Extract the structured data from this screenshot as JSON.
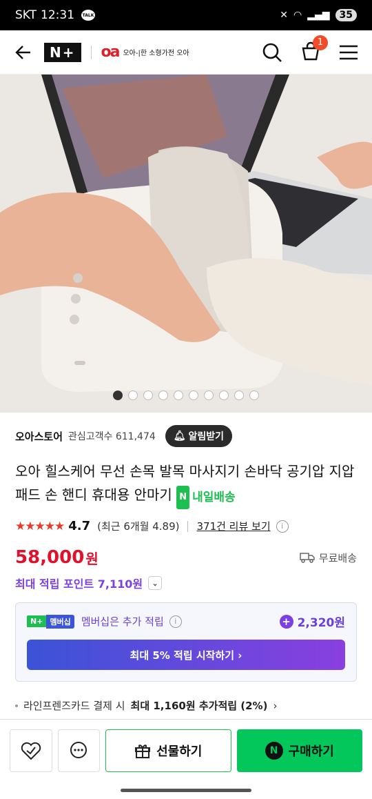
{
  "status": {
    "carrier": "SKT",
    "time": "12:31",
    "talk": "TALK",
    "battery": "35"
  },
  "header": {
    "nplus": "N+",
    "brand_logo": "oa",
    "brand_text": "오아-|한 소형가전 오아",
    "cart_count": "1"
  },
  "hero": {
    "image_alt": "손목 마사지기 제품 이미지",
    "dots_total": 10,
    "dots_active": 0
  },
  "store": {
    "name": "오아스토어",
    "followers": "관심고객수 611,474",
    "alarm": "알림받기"
  },
  "product": {
    "title": "오아 힐스케어 무선 손목 발목 마사지기 손바닥 공기압 지압패드 손 핸디 휴대용 안마기",
    "delivery_badge": "N",
    "delivery_text": "내일배송"
  },
  "rating": {
    "stars": "★★★★★",
    "value": "4.7",
    "recent": "(최근 6개월 4.89)",
    "review_link": "371건 리뷰 보기",
    "info": "i"
  },
  "price": {
    "amount": "58,000",
    "unit": "원",
    "shipping": "무료배송"
  },
  "points": {
    "text": "최대 적립 포인트 7,110원",
    "chevron": "⌄"
  },
  "membership": {
    "badge_np": "N+",
    "badge_mb": "멤버십",
    "text": "멤버십은 추가 적립",
    "info": "i",
    "amount": "2,320원",
    "button": "최대 5% 적립 시작하기 ›"
  },
  "card_offer": {
    "prefix": "라인프렌즈카드 결제 시",
    "highlight": "최대 1,160원 추가적립 (2%)",
    "chevron": "›"
  },
  "bottom": {
    "gift": "선물하기",
    "buy": "구매하기",
    "n": "N"
  }
}
